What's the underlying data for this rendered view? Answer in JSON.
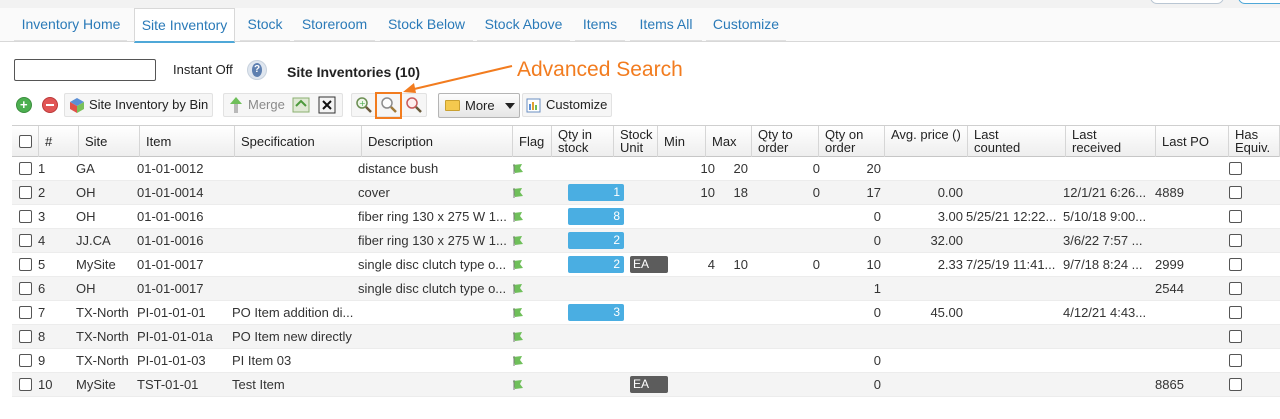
{
  "tabs": [
    {
      "label": "Inventory Home",
      "active": false
    },
    {
      "label": "Site Inventory",
      "active": true
    },
    {
      "label": "Stock",
      "active": false
    },
    {
      "label": "Storeroom",
      "active": false
    },
    {
      "label": "Stock Below",
      "active": false
    },
    {
      "label": "Stock Above",
      "active": false
    },
    {
      "label": "Items",
      "active": false
    },
    {
      "label": "Items All",
      "active": false
    },
    {
      "label": "Customize",
      "active": false
    }
  ],
  "search": {
    "value": "",
    "instant_label": "Instant Off"
  },
  "page_title": "Site Inventories (10)",
  "annotation": {
    "text": "Advanced Search",
    "color": "#f27c1f"
  },
  "toolbar": {
    "add_icon": "add-icon",
    "delete_icon": "delete-icon",
    "bin_label": "Site Inventory by Bin",
    "merge_label": "Merge",
    "more_label": "More",
    "customize_label": "Customize"
  },
  "columns": [
    {
      "label": "#"
    },
    {
      "label": "Site"
    },
    {
      "label": "Item"
    },
    {
      "label": "Specification"
    },
    {
      "label": "Description"
    },
    {
      "label": "Flag"
    },
    {
      "label": "Qty in stock"
    },
    {
      "label": "Stock Unit"
    },
    {
      "label": "Min"
    },
    {
      "label": "Max"
    },
    {
      "label": "Qty to order"
    },
    {
      "label": "Qty on order"
    },
    {
      "label": "Avg. price ()"
    },
    {
      "label": "Last counted"
    },
    {
      "label": "Last received"
    },
    {
      "label": "Last PO"
    },
    {
      "label": "Has Equiv."
    }
  ],
  "rows": [
    {
      "n": "1",
      "site": "GA",
      "item": "01-01-0012",
      "spec": "",
      "desc": "distance bush",
      "qty_stock": "",
      "qty_level": 0,
      "unit": "",
      "min": "10",
      "max": "20",
      "to_order": "0",
      "on_order": "20",
      "avg": "",
      "counted": "",
      "received": "",
      "po": ""
    },
    {
      "n": "2",
      "site": "OH",
      "item": "01-01-0014",
      "spec": "",
      "desc": "cover",
      "qty_stock": "1",
      "qty_level": 1,
      "unit": "",
      "min": "10",
      "max": "18",
      "to_order": "0",
      "on_order": "17",
      "avg": "0.00",
      "counted": "",
      "received": "12/1/21 6:26...",
      "po": "4889"
    },
    {
      "n": "3",
      "site": "OH",
      "item": "01-01-0016",
      "spec": "",
      "desc": "fiber ring 130 x 275 W 1...",
      "qty_stock": "8",
      "qty_level": 1,
      "unit": "",
      "min": "",
      "max": "",
      "to_order": "",
      "on_order": "0",
      "avg": "3.00",
      "counted": "5/25/21 12:22...",
      "received": "5/10/18 9:00...",
      "po": ""
    },
    {
      "n": "4",
      "site": "JJ.CA",
      "item": "01-01-0016",
      "spec": "",
      "desc": "fiber ring 130 x 275 W 1...",
      "qty_stock": "2",
      "qty_level": 1,
      "unit": "",
      "min": "",
      "max": "",
      "to_order": "",
      "on_order": "0",
      "avg": "32.00",
      "counted": "",
      "received": "3/6/22 7:57 ...",
      "po": ""
    },
    {
      "n": "5",
      "site": "MySite",
      "item": "01-01-0017",
      "spec": "",
      "desc": "single disc clutch type o...",
      "qty_stock": "2",
      "qty_level": 1,
      "unit": "EA",
      "min": "4",
      "max": "10",
      "to_order": "0",
      "on_order": "10",
      "avg": "2.33",
      "counted": "7/25/19 11:41...",
      "received": "9/7/18 8:24 ...",
      "po": "2999"
    },
    {
      "n": "6",
      "site": "OH",
      "item": "01-01-0017",
      "spec": "",
      "desc": "single disc clutch type o...",
      "qty_stock": "",
      "qty_level": 0,
      "unit": "",
      "min": "",
      "max": "",
      "to_order": "",
      "on_order": "1",
      "avg": "",
      "counted": "",
      "received": "",
      "po": "2544"
    },
    {
      "n": "7",
      "site": "TX-North",
      "item": "PI-01-01-01",
      "spec": "PO Item addition di...",
      "desc": "",
      "qty_stock": "3",
      "qty_level": 1,
      "unit": "",
      "min": "",
      "max": "",
      "to_order": "",
      "on_order": "0",
      "avg": "45.00",
      "counted": "",
      "received": "4/12/21 4:43...",
      "po": ""
    },
    {
      "n": "8",
      "site": "TX-North",
      "item": "PI-01-01-01a",
      "spec": "PO Item new directly",
      "desc": "",
      "qty_stock": "",
      "qty_level": 0,
      "unit": "",
      "min": "",
      "max": "",
      "to_order": "",
      "on_order": "",
      "avg": "",
      "counted": "",
      "received": "",
      "po": ""
    },
    {
      "n": "9",
      "site": "TX-North",
      "item": "PI-01-01-03",
      "spec": "PI Item 03",
      "desc": "",
      "qty_stock": "",
      "qty_level": 0,
      "unit": "",
      "min": "",
      "max": "",
      "to_order": "",
      "on_order": "0",
      "avg": "",
      "counted": "",
      "received": "",
      "po": ""
    },
    {
      "n": "10",
      "site": "MySite",
      "item": "TST-01-01",
      "spec": "Test Item",
      "desc": "",
      "qty_stock": "",
      "qty_level": 0,
      "unit": "EA",
      "min": "",
      "max": "",
      "to_order": "",
      "on_order": "0",
      "avg": "",
      "counted": "",
      "received": "",
      "po": "8865"
    }
  ],
  "colors": {
    "accent": "#2a7ab8",
    "qty_bar": "#4aaee2",
    "unit_badge": "#5c5c5c",
    "flag": "#6fbf5a"
  }
}
